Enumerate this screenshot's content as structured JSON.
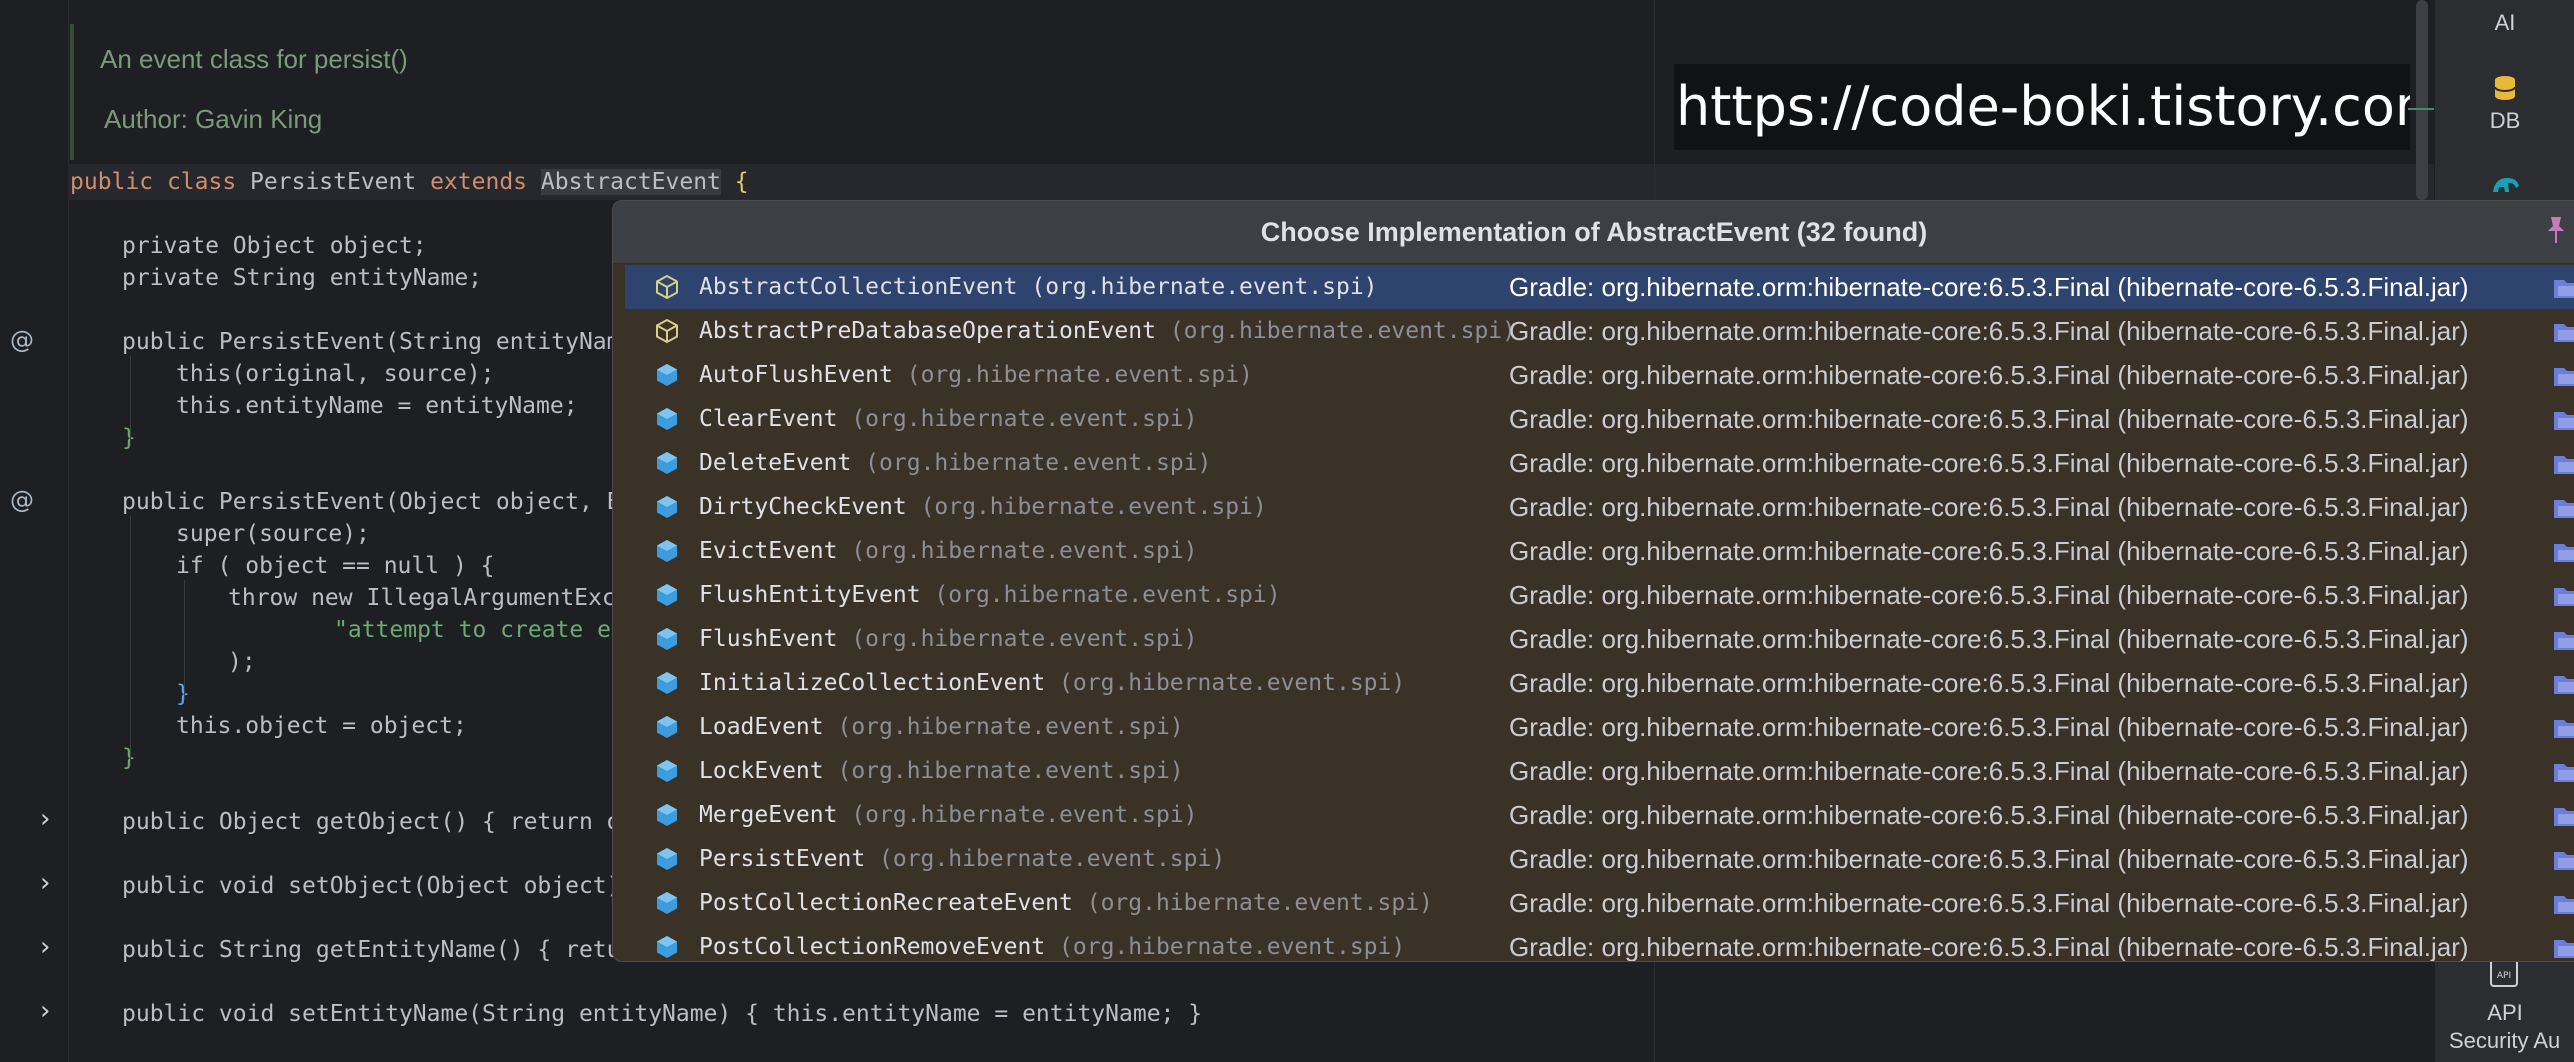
{
  "doc": {
    "line1": "An event class for persist()",
    "author_label": "Author:",
    "author_value": "Gavin King"
  },
  "code": {
    "class_decl": [
      "public",
      " ",
      "class",
      " PersistEvent ",
      "extends",
      " ",
      "AbstractEvent",
      " {"
    ],
    "lines": [
      "private Object object;",
      "private String entityName;",
      "public PersistEvent(String entityName",
      "this(original, source);",
      "this.entityName = entityName;",
      "}",
      "public PersistEvent(Object object, Ev",
      "super(source);",
      "if ( object == null ) {",
      "throw new IllegalArgumentExce",
      "\"attempt to create ev",
      ");",
      "}",
      "this.object = object;",
      "}",
      "public Object getObject() { return ob",
      "public void setObject(Object object)",
      "public String getEntityName() { retur",
      "public void setEntityName(String entityName) { this.entityName = entityName; }"
    ]
  },
  "watermark": "https://code-boki.tistory.com",
  "right_sidebar": {
    "ai_label": "AI",
    "db_label": "DB",
    "api_label_1": "API",
    "api_label_2": "Security Au"
  },
  "popup": {
    "title": "Choose Implementation of AbstractEvent (32 found)",
    "library": "Gradle: org.hibernate.orm:hibernate-core:6.5.3.Final (hibernate-core-6.5.3.Final.jar)",
    "items": [
      {
        "name": "AbstractCollectionEvent",
        "pkg": "(org.hibernate.event.spi)",
        "abstract": true
      },
      {
        "name": "AbstractPreDatabaseOperationEvent",
        "pkg": "(org.hibernate.event.spi)",
        "abstract": true
      },
      {
        "name": "AutoFlushEvent",
        "pkg": "(org.hibernate.event.spi)",
        "abstract": false
      },
      {
        "name": "ClearEvent",
        "pkg": "(org.hibernate.event.spi)",
        "abstract": false
      },
      {
        "name": "DeleteEvent",
        "pkg": "(org.hibernate.event.spi)",
        "abstract": false
      },
      {
        "name": "DirtyCheckEvent",
        "pkg": "(org.hibernate.event.spi)",
        "abstract": false
      },
      {
        "name": "EvictEvent",
        "pkg": "(org.hibernate.event.spi)",
        "abstract": false
      },
      {
        "name": "FlushEntityEvent",
        "pkg": "(org.hibernate.event.spi)",
        "abstract": false
      },
      {
        "name": "FlushEvent",
        "pkg": "(org.hibernate.event.spi)",
        "abstract": false
      },
      {
        "name": "InitializeCollectionEvent",
        "pkg": "(org.hibernate.event.spi)",
        "abstract": false
      },
      {
        "name": "LoadEvent",
        "pkg": "(org.hibernate.event.spi)",
        "abstract": false
      },
      {
        "name": "LockEvent",
        "pkg": "(org.hibernate.event.spi)",
        "abstract": false
      },
      {
        "name": "MergeEvent",
        "pkg": "(org.hibernate.event.spi)",
        "abstract": false
      },
      {
        "name": "PersistEvent",
        "pkg": "(org.hibernate.event.spi)",
        "abstract": false
      },
      {
        "name": "PostCollectionRecreateEvent",
        "pkg": "(org.hibernate.event.spi)",
        "abstract": false
      },
      {
        "name": "PostCollectionRemoveEvent",
        "pkg": "(org.hibernate.event.spi)",
        "abstract": false
      }
    ],
    "selected_index": 0
  },
  "colors": {
    "popup_bg": "#3a3127",
    "selected_row": "#2e436e",
    "class_icon_blue": "#3d9cde",
    "abstract_icon_yellow": "#d6cf8a",
    "keyword": "#cf8e6d",
    "field": "#c77dbb",
    "method": "#56a8f5",
    "string": "#6aab73"
  },
  "icons": {
    "class": "class-icon",
    "abstract_class": "abstract-class-icon",
    "library": "library-folder-icon",
    "pin": "pin-icon",
    "override_gutter": "at-override-icon",
    "fold": "chevron-right-icon"
  }
}
